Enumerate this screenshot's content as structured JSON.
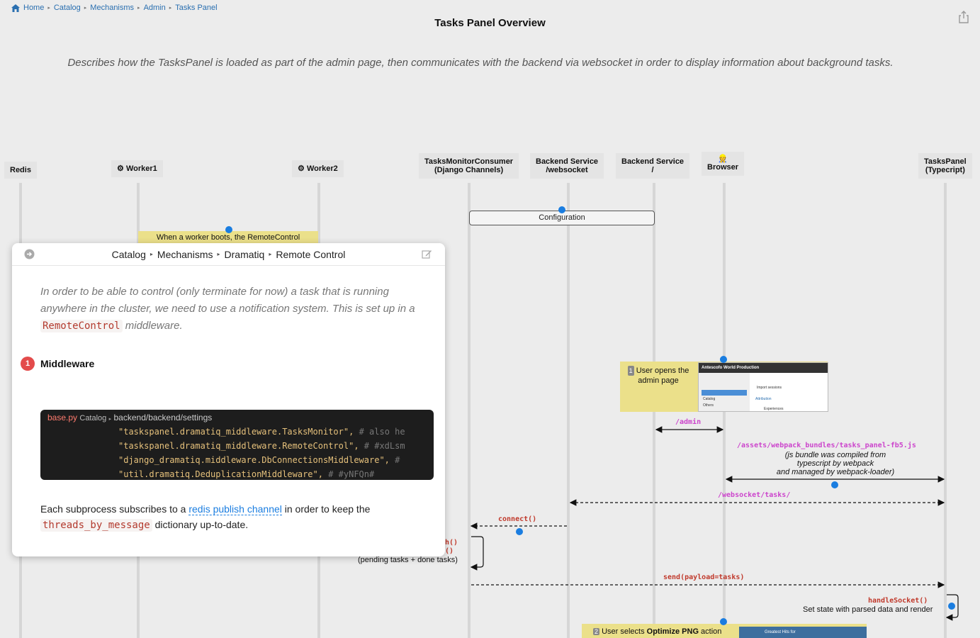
{
  "breadcrumb": {
    "items": [
      "Home",
      "Catalog",
      "Mechanisms",
      "Admin",
      "Tasks Panel"
    ]
  },
  "page": {
    "title": "Tasks Panel Overview",
    "description": "Describes how the TasksPanel is loaded as part of the admin page, then communicates with the backend via websocket in order to display information about background tasks."
  },
  "participants": [
    {
      "id": "redis",
      "line1": "Redis",
      "line2": "",
      "icon": ""
    },
    {
      "id": "worker1",
      "line1": "Worker1",
      "line2": "",
      "icon": "gear-icon"
    },
    {
      "id": "worker2",
      "line1": "Worker2",
      "line2": "",
      "icon": "gear-icon"
    },
    {
      "id": "consumer",
      "line1": "TasksMonitorConsumer",
      "line2": "(Django Channels)",
      "icon": ""
    },
    {
      "id": "backend-ws",
      "line1": "Backend Service",
      "line2": "/websocket",
      "icon": ""
    },
    {
      "id": "backend-root",
      "line1": "Backend Service",
      "line2": "/",
      "icon": ""
    },
    {
      "id": "browser",
      "line1": "Browser",
      "line2": "",
      "icon": "person-icon"
    },
    {
      "id": "taskspanel",
      "line1": "TasksPanel",
      "line2": "(Typecript)",
      "icon": ""
    }
  ],
  "diagram": {
    "configuration_label": "Configuration",
    "worker_note": "When a worker boots, the RemoteControl",
    "user_opens_note": "User opens the admin page",
    "user_opens_step": "1",
    "admin_screenshot": {
      "title": "Antescofo World Production",
      "items": [
        "Import sessions",
        "Attribution",
        "Experiences",
        "Catalog",
        "Others"
      ]
    },
    "arrow_admin": "/admin",
    "arrow_assets": "/assets/webpack_bundles/tasks_panel-fb5.js",
    "assets_note_1": "(js bundle was compiled from",
    "assets_note_2": "typescript by webpack",
    "assets_note_3": "and managed by webpack-loader)",
    "arrow_websocket": "/websocket/tasks/",
    "arrow_connect": "connect()",
    "self_label_1": "h()",
    "self_label_2": "()",
    "self_note": "(pending tasks + done tasks)",
    "arrow_send": "send(payload=tasks)",
    "handle_label": "handleSocket()",
    "handle_note": "Set state with parsed data and render",
    "optimize_step": "2",
    "optimize_prefix": "User selects ",
    "optimize_bold": "Optimize PNG",
    "optimize_suffix": " action",
    "optimize_screenshot_text": "Greatest Hits for"
  },
  "popup": {
    "breadcrumb": [
      "Catalog",
      "Mechanisms",
      "Dramatiq",
      "Remote Control"
    ],
    "intro_1": "In order to be able to control (only terminate for now) a task that is running anywhere in the cluster, we need to use a notification system. This is set up in a ",
    "intro_code": "RemoteControl",
    "intro_2": " middleware.",
    "section_number": "1",
    "section_title": "Middleware",
    "code": {
      "filename": "base.py",
      "path_prefix": "Catalog",
      "path": "backend/backend/settings",
      "lines": [
        {
          "code": "\"taskspanel.dramatiq_middleware.TasksMonitor\",",
          "comment": "  # also he"
        },
        {
          "code": "\"taskspanel.dramatiq_middleware.RemoteControl\",",
          "comment": "  # #xdLsm"
        },
        {
          "code": "\"django_dramatiq.middleware.DbConnectionsMiddleware\",",
          "comment": "  # "
        },
        {
          "code": "\"util.dramatiq.DeduplicationMiddleware\",",
          "comment": "  # #yNFQn#"
        }
      ]
    },
    "footer_1": "Each subprocess subscribes to a ",
    "footer_link": "redis publish channel",
    "footer_2": " in order to keep the ",
    "footer_code": "threads_by_message",
    "footer_3": " dictionary up-to-date."
  },
  "colors": {
    "accent": "#1a7de0",
    "note_yellow": "#ebe08a",
    "arrow_label": "#c0392b",
    "magenta": "#cc44cc",
    "badge_red": "#e34b4b"
  }
}
